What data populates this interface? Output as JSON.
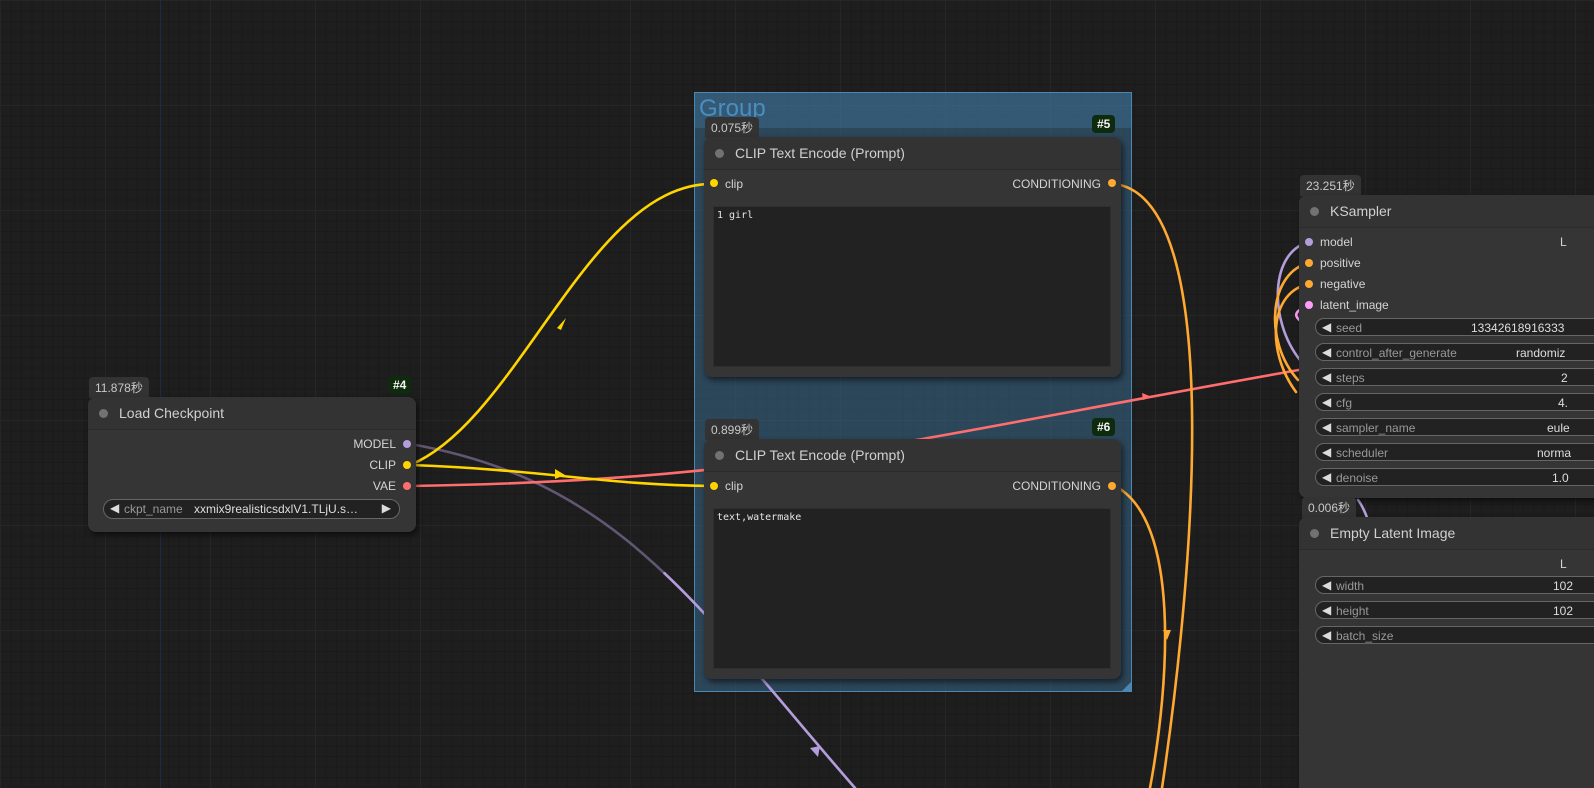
{
  "colors": {
    "clip": "#ffd500",
    "model": "#b39ddb",
    "vae": "#ff6e6e",
    "conditioning": "#ffa931",
    "latent": "#ff9cf9",
    "group": "#4a88b3"
  },
  "group": {
    "title": "Group"
  },
  "load_checkpoint": {
    "timing": "11.878秒",
    "id": "#4",
    "title": "Load Checkpoint",
    "outputs": [
      "MODEL",
      "CLIP",
      "VAE"
    ],
    "ckpt_label": "ckpt_name",
    "ckpt_value": "xxmix9realisticsdxlV1.TLjU.s…"
  },
  "clip_pos": {
    "timing": "0.075秒",
    "id": "#5",
    "title": "CLIP Text Encode (Prompt)",
    "input": "clip",
    "output": "CONDITIONING",
    "text": "1 girl"
  },
  "clip_neg": {
    "timing": "0.899秒",
    "id": "#6",
    "title": "CLIP Text Encode (Prompt)",
    "input": "clip",
    "output": "CONDITIONING",
    "text": "text,watermake"
  },
  "ksampler": {
    "timing": "23.251秒",
    "title": "KSampler",
    "output_partial": "L",
    "inputs": [
      "model",
      "positive",
      "negative",
      "latent_image"
    ],
    "widgets": [
      {
        "label": "seed",
        "value": "13342618916333"
      },
      {
        "label": "control_after_generate",
        "value": "randomiz"
      },
      {
        "label": "steps",
        "value": "2"
      },
      {
        "label": "cfg",
        "value": "4."
      },
      {
        "label": "sampler_name",
        "value": "eule"
      },
      {
        "label": "scheduler",
        "value": "norma"
      },
      {
        "label": "denoise",
        "value": "1.0"
      }
    ]
  },
  "empty_latent": {
    "timing": "0.006秒",
    "title": "Empty Latent Image",
    "output_partial": "L",
    "widgets": [
      {
        "label": "width",
        "value": "102"
      },
      {
        "label": "height",
        "value": "102"
      },
      {
        "label": "batch_size",
        "value": ""
      }
    ]
  }
}
